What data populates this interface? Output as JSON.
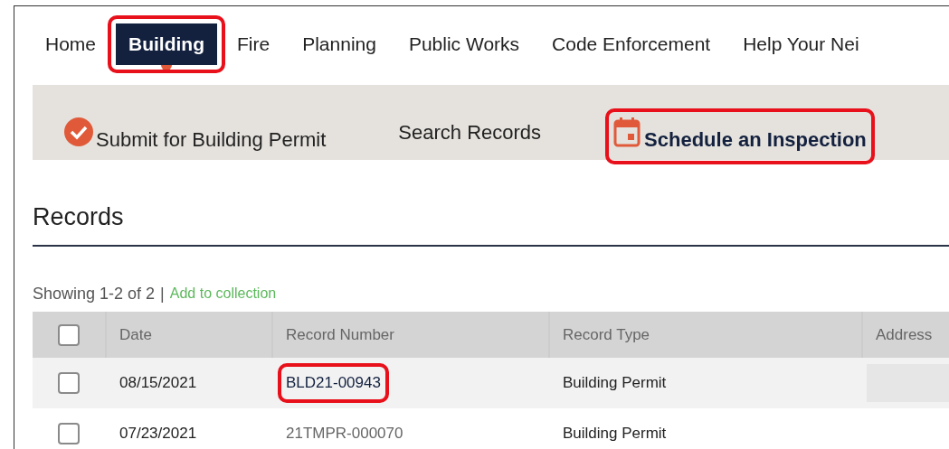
{
  "nav": [
    {
      "label": "Home",
      "selected": false,
      "highlighted": false
    },
    {
      "label": "Building",
      "selected": true,
      "highlighted": true
    },
    {
      "label": "Fire",
      "selected": false,
      "highlighted": false
    },
    {
      "label": "Planning",
      "selected": false,
      "highlighted": false
    },
    {
      "label": "Public Works",
      "selected": false,
      "highlighted": false
    },
    {
      "label": "Code Enforcement",
      "selected": false,
      "highlighted": false
    },
    {
      "label": "Help Your Nei",
      "selected": false,
      "highlighted": false
    }
  ],
  "subnav": [
    {
      "label": "Submit for Building Permit",
      "kind": "check",
      "highlighted": false
    },
    {
      "label": "Search Records",
      "kind": "plain",
      "highlighted": false
    },
    {
      "label": "Schedule an Inspection",
      "kind": "calendar",
      "highlighted": true
    }
  ],
  "heading": "Records",
  "summary": {
    "text": "Showing 1-2 of 2",
    "separator": "|",
    "link": "Add to collection"
  },
  "table": {
    "select_all": {
      "checked": false
    },
    "columns": [
      "Date",
      "Record Number",
      "Record Type",
      "Address"
    ],
    "rows": [
      {
        "checked": false,
        "date": "08/15/2021",
        "record_number": "BLD21-00943",
        "link": true,
        "highlighted": true,
        "record_type": "Building Permit",
        "address_redacted": true
      },
      {
        "checked": false,
        "date": "07/23/2021",
        "record_number": "21TMPR-000070",
        "link": false,
        "highlighted": false,
        "record_type": "Building Permit",
        "address_redacted": false
      }
    ]
  }
}
